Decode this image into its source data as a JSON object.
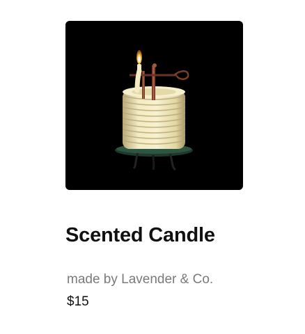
{
  "product": {
    "image_alt": "coiled candle",
    "title": "Scented Candle",
    "maker": "made by Lavender & Co.",
    "price": "$15"
  },
  "colors": {
    "background": "#ffffff",
    "image_background": "#000000",
    "title_text": "#111111",
    "maker_text": "#7a7a7a",
    "price_text": "#111111",
    "wax": "#efe6b8",
    "copper": "#8a4a30"
  }
}
